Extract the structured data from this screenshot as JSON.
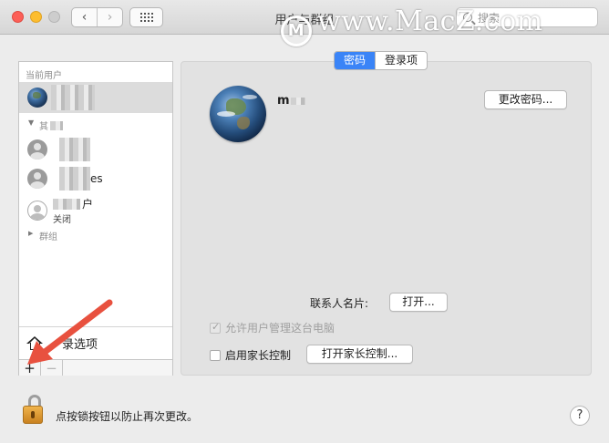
{
  "window": {
    "title": "用户与群组",
    "search_placeholder": "搜索",
    "watermark": "www.MacZ.com",
    "watermark_logo": "M"
  },
  "nav": {
    "back_glyph": "‹",
    "forward_glyph": "›"
  },
  "sidebar": {
    "current_users_header": "当前用户",
    "other_users_header": "其",
    "groups_header": "群组",
    "users": [
      {
        "suffix": ""
      },
      {
        "suffix": ""
      },
      {
        "suffix": "es"
      },
      {
        "suffix": "户",
        "sub": "关闭"
      }
    ],
    "login_options_label": "登录选项",
    "login_options_visible": "录选项",
    "add_glyph": "+",
    "remove_glyph": "−"
  },
  "tabs": [
    {
      "label": "密码",
      "active": true
    },
    {
      "label": "登录项",
      "active": false
    }
  ],
  "user_detail": {
    "name": "m",
    "change_password_label": "更改密码...",
    "contact_card_label": "联系人名片:",
    "open_label": "打开...",
    "allow_admin_label": "允许用户管理这台电脑",
    "allow_admin_checked": true,
    "parental_control_label": "启用家长控制",
    "parental_control_checked": false,
    "open_parental_label": "打开家长控制..."
  },
  "footer": {
    "lock_text": "点按锁按钮以防止再次更改。",
    "help_label": "?"
  },
  "colors": {
    "accent": "#3a84f7",
    "arrow": "#e8513f",
    "selected_row": "#dcdcdc"
  }
}
